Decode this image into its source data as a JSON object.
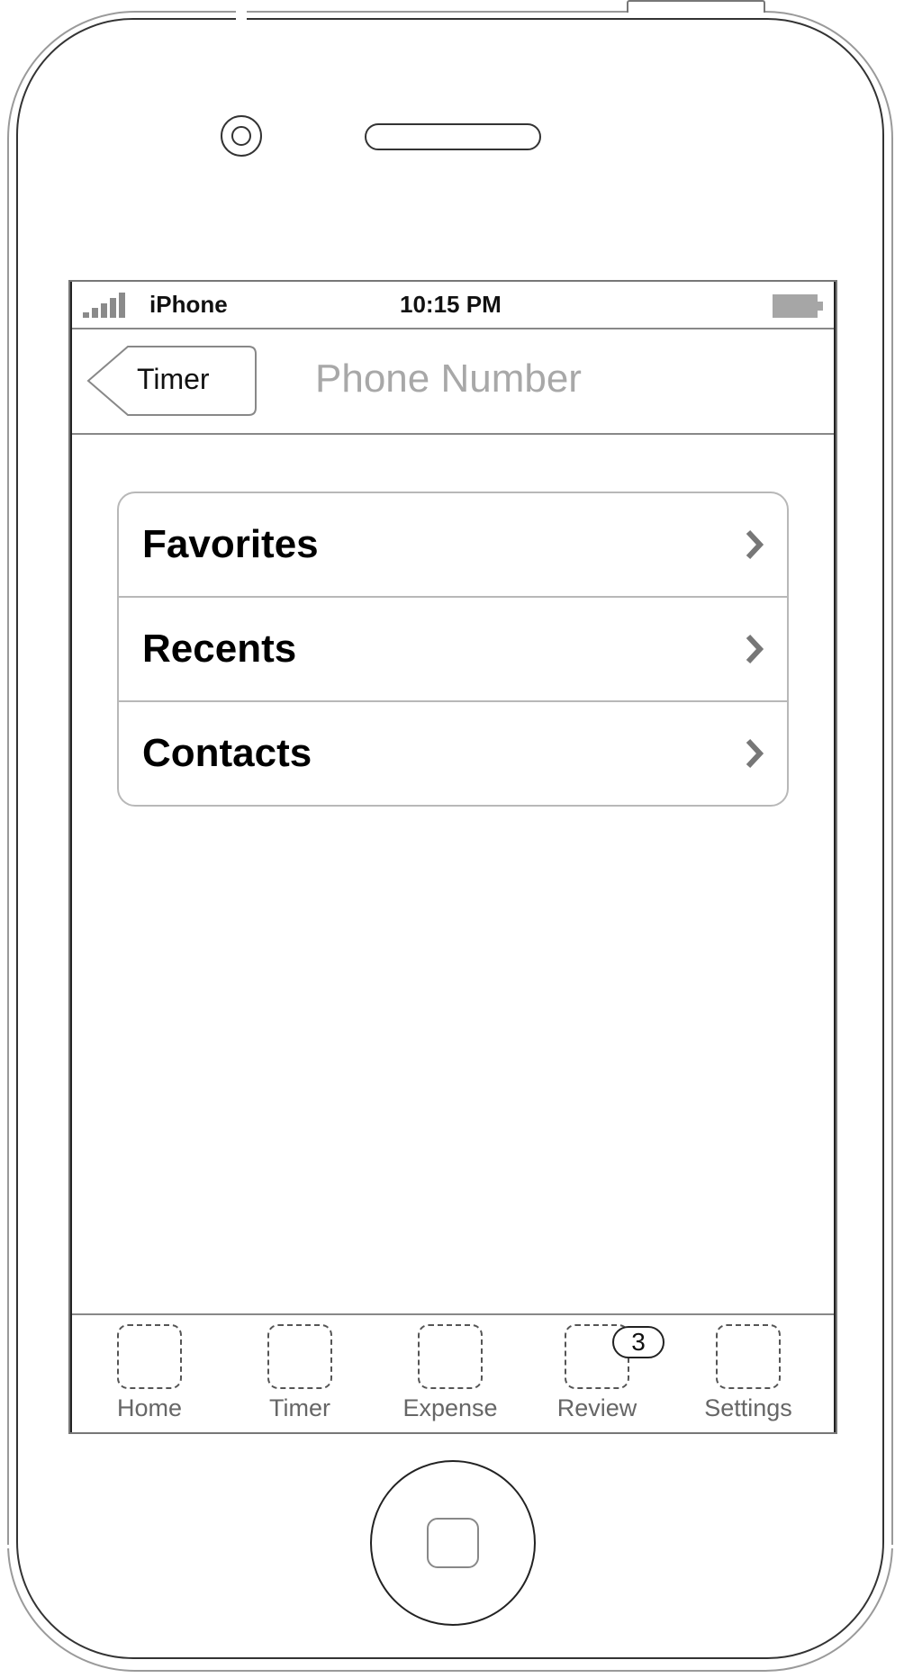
{
  "status_bar": {
    "carrier": "iPhone",
    "time": "10:15 PM",
    "signal_icon": "signal-bars-icon",
    "battery_icon": "battery-icon"
  },
  "nav_bar": {
    "back_label": "Timer",
    "title": "Phone Number"
  },
  "menu": {
    "items": [
      {
        "label": "Favorites",
        "icon": "chevron-right-icon"
      },
      {
        "label": "Recents",
        "icon": "chevron-right-icon"
      },
      {
        "label": "Contacts",
        "icon": "chevron-right-icon"
      }
    ]
  },
  "tab_bar": {
    "tabs": [
      {
        "label": "Home",
        "icon": "placeholder-icon"
      },
      {
        "label": "Timer",
        "icon": "placeholder-icon"
      },
      {
        "label": "Expense",
        "icon": "placeholder-icon"
      },
      {
        "label": "Review",
        "icon": "placeholder-icon",
        "badge": "3"
      },
      {
        "label": "Settings",
        "icon": "placeholder-icon"
      }
    ]
  },
  "colors": {
    "title_gray": "#a8a8a8",
    "tab_label_gray": "#666666",
    "chevron_gray": "#777777",
    "battery_gray": "#a6a6a6"
  }
}
